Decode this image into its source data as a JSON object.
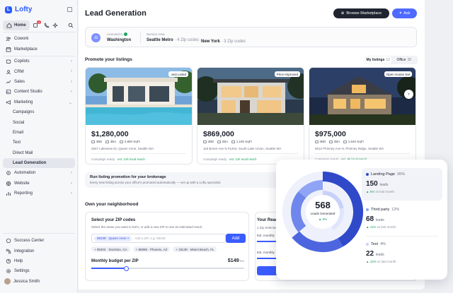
{
  "sidebar": {
    "logo": "Lofty",
    "home": "Home",
    "notif_count": "4",
    "groups": [
      {
        "label": "Cowork"
      },
      {
        "label": "Marketplace"
      }
    ],
    "items": [
      {
        "label": "Copilots"
      },
      {
        "label": "CRM"
      },
      {
        "label": "Sales"
      },
      {
        "label": "Content Studio"
      },
      {
        "label": "Marketing"
      },
      {
        "label": "Campaigns"
      },
      {
        "label": "Social"
      },
      {
        "label": "Email"
      },
      {
        "label": "Text"
      },
      {
        "label": "Direct Mail"
      },
      {
        "label": "Lead Generation"
      },
      {
        "label": "Automation"
      },
      {
        "label": "Website"
      },
      {
        "label": "Reporting"
      }
    ],
    "bottom": [
      {
        "label": "Success Center"
      },
      {
        "label": "Integration"
      },
      {
        "label": "Help"
      },
      {
        "label": "Settings"
      }
    ],
    "user": "Jessica Smith"
  },
  "header": {
    "title": "Lead Generation",
    "browse_label": "Browse Marketplace",
    "ask_label": "Ask"
  },
  "license": {
    "initials": "JS",
    "licensed_caption": "Licensed in",
    "licensed_value": "Washington",
    "service_caption": "Service Area",
    "area1_name": "Seattle Metro",
    "area1_count": "· 4 Zip codes",
    "area2_name": "New York",
    "area2_count": "· 3 Zip codes"
  },
  "listings": {
    "title": "Promote your listings",
    "tab_mine": "My listings",
    "tab_mine_count": "12",
    "tab_office": "Office",
    "tab_office_count": "38",
    "cards": [
      {
        "tag": "Just Listed",
        "price": "$1,280,000",
        "beds": "4BD",
        "baths": "3BA",
        "sqft": "2,850 SqFt",
        "address": "2847 Lakeview Dr, Queen Anne, Seattle WA",
        "ready": "Campaign ready ·",
        "reach": "est. 14k local reach"
      },
      {
        "tag": "Price Improved",
        "price": "$869,000",
        "beds": "2BD",
        "baths": "2BA",
        "sqft": "1,180 SqFt",
        "address": "118 Boren Ave N #1204, South Lake Union, Seattle WA",
        "ready": "Campaign ready ·",
        "reach": "est. 11k local reach"
      },
      {
        "tag": "Open House Sat",
        "price": "$975,000",
        "beds": "3BD",
        "baths": "2BA",
        "sqft": "1,640 SqFt",
        "address": "5512 Phinney Ave N, Phinney Ridge, Seattle WA",
        "ready": "Campaign ready ·",
        "reach": "est. 9k local reach"
      }
    ],
    "next_arrow": "›"
  },
  "promo": {
    "title": "Run listing promotion for your brokerage",
    "subtitle": "Every new listing across your office's promoted automatically — set up with a Lofty specialist."
  },
  "neighborhood": {
    "title": "Own your neighborhood",
    "zip_title": "Select your ZIP codes",
    "zip_subtitle": "Select the areas you want to farm, or add a new ZIP to see its estimated reach.",
    "selected_chip": "98109 · Queen Anne ×",
    "placeholder": "Add a ZIP, e.g. 98109",
    "add_label": "Add",
    "chips": [
      "+ 95202 · Stockton, CA",
      "+ 85085 · Phoenix, AZ",
      "+ 33139 · Miami Beach, FL"
    ],
    "budget_label": "Monthly budget per ZIP",
    "budget_value": "$149",
    "budget_unit": "/mo",
    "budget_fraction": 0.23,
    "reach_title": "Your Reach",
    "reach_subtitle": "1 Zip Selected",
    "est_monthly_1": "Est. monthly",
    "est_monthly_2": "Est. monthly",
    "reach_bar_fraction_1": 0.45,
    "reach_bar_fraction_2": 0.45
  },
  "overlay": {
    "total": "568",
    "total_label": "Leads Generated",
    "total_delta": "▲ 8%",
    "segments": [
      {
        "name": "Landing Page",
        "pct": "26%",
        "leads": "150",
        "unit": "leads",
        "delta": "▲ 6%",
        "delta_note": "vs last month",
        "color": "#2f49c9",
        "share": 0.26
      },
      {
        "name": "Third party",
        "pct": "12%",
        "leads": "68",
        "unit": "leads",
        "delta": "▲ 11%",
        "delta_note": "vs last month",
        "color": "#8fa4f5",
        "share": 0.12
      },
      {
        "name": "Text",
        "pct": "4%",
        "leads": "22",
        "unit": "leads",
        "delta": "▲ 15%",
        "delta_note": "vs last month",
        "color": "#c7d1fa",
        "share": 0.04
      }
    ]
  },
  "colors": {
    "accent": "#3a5cff",
    "dark_button": "#1f2430",
    "positive": "#1fa463"
  }
}
